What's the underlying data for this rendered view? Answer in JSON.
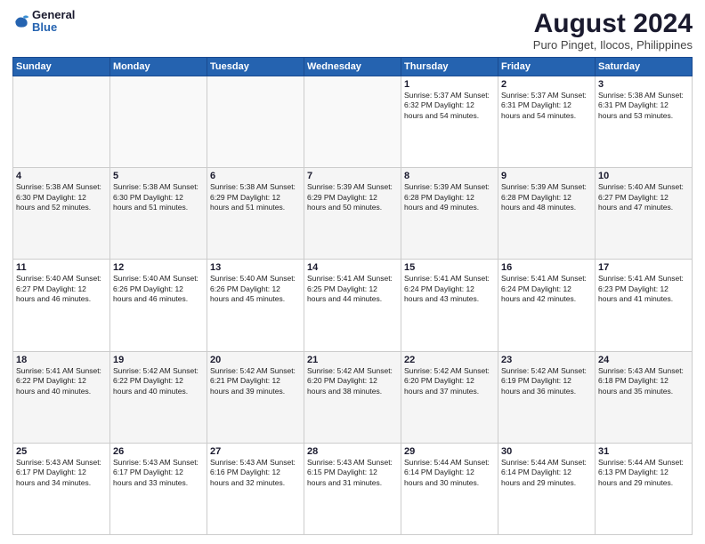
{
  "header": {
    "logo_line1": "General",
    "logo_line2": "Blue",
    "month_year": "August 2024",
    "location": "Puro Pinget, Ilocos, Philippines"
  },
  "days_of_week": [
    "Sunday",
    "Monday",
    "Tuesday",
    "Wednesday",
    "Thursday",
    "Friday",
    "Saturday"
  ],
  "weeks": [
    [
      {
        "day": "",
        "text": ""
      },
      {
        "day": "",
        "text": ""
      },
      {
        "day": "",
        "text": ""
      },
      {
        "day": "",
        "text": ""
      },
      {
        "day": "1",
        "text": "Sunrise: 5:37 AM\nSunset: 6:32 PM\nDaylight: 12 hours\nand 54 minutes."
      },
      {
        "day": "2",
        "text": "Sunrise: 5:37 AM\nSunset: 6:31 PM\nDaylight: 12 hours\nand 54 minutes."
      },
      {
        "day": "3",
        "text": "Sunrise: 5:38 AM\nSunset: 6:31 PM\nDaylight: 12 hours\nand 53 minutes."
      }
    ],
    [
      {
        "day": "4",
        "text": "Sunrise: 5:38 AM\nSunset: 6:30 PM\nDaylight: 12 hours\nand 52 minutes."
      },
      {
        "day": "5",
        "text": "Sunrise: 5:38 AM\nSunset: 6:30 PM\nDaylight: 12 hours\nand 51 minutes."
      },
      {
        "day": "6",
        "text": "Sunrise: 5:38 AM\nSunset: 6:29 PM\nDaylight: 12 hours\nand 51 minutes."
      },
      {
        "day": "7",
        "text": "Sunrise: 5:39 AM\nSunset: 6:29 PM\nDaylight: 12 hours\nand 50 minutes."
      },
      {
        "day": "8",
        "text": "Sunrise: 5:39 AM\nSunset: 6:28 PM\nDaylight: 12 hours\nand 49 minutes."
      },
      {
        "day": "9",
        "text": "Sunrise: 5:39 AM\nSunset: 6:28 PM\nDaylight: 12 hours\nand 48 minutes."
      },
      {
        "day": "10",
        "text": "Sunrise: 5:40 AM\nSunset: 6:27 PM\nDaylight: 12 hours\nand 47 minutes."
      }
    ],
    [
      {
        "day": "11",
        "text": "Sunrise: 5:40 AM\nSunset: 6:27 PM\nDaylight: 12 hours\nand 46 minutes."
      },
      {
        "day": "12",
        "text": "Sunrise: 5:40 AM\nSunset: 6:26 PM\nDaylight: 12 hours\nand 46 minutes."
      },
      {
        "day": "13",
        "text": "Sunrise: 5:40 AM\nSunset: 6:26 PM\nDaylight: 12 hours\nand 45 minutes."
      },
      {
        "day": "14",
        "text": "Sunrise: 5:41 AM\nSunset: 6:25 PM\nDaylight: 12 hours\nand 44 minutes."
      },
      {
        "day": "15",
        "text": "Sunrise: 5:41 AM\nSunset: 6:24 PM\nDaylight: 12 hours\nand 43 minutes."
      },
      {
        "day": "16",
        "text": "Sunrise: 5:41 AM\nSunset: 6:24 PM\nDaylight: 12 hours\nand 42 minutes."
      },
      {
        "day": "17",
        "text": "Sunrise: 5:41 AM\nSunset: 6:23 PM\nDaylight: 12 hours\nand 41 minutes."
      }
    ],
    [
      {
        "day": "18",
        "text": "Sunrise: 5:41 AM\nSunset: 6:22 PM\nDaylight: 12 hours\nand 40 minutes."
      },
      {
        "day": "19",
        "text": "Sunrise: 5:42 AM\nSunset: 6:22 PM\nDaylight: 12 hours\nand 40 minutes."
      },
      {
        "day": "20",
        "text": "Sunrise: 5:42 AM\nSunset: 6:21 PM\nDaylight: 12 hours\nand 39 minutes."
      },
      {
        "day": "21",
        "text": "Sunrise: 5:42 AM\nSunset: 6:20 PM\nDaylight: 12 hours\nand 38 minutes."
      },
      {
        "day": "22",
        "text": "Sunrise: 5:42 AM\nSunset: 6:20 PM\nDaylight: 12 hours\nand 37 minutes."
      },
      {
        "day": "23",
        "text": "Sunrise: 5:42 AM\nSunset: 6:19 PM\nDaylight: 12 hours\nand 36 minutes."
      },
      {
        "day": "24",
        "text": "Sunrise: 5:43 AM\nSunset: 6:18 PM\nDaylight: 12 hours\nand 35 minutes."
      }
    ],
    [
      {
        "day": "25",
        "text": "Sunrise: 5:43 AM\nSunset: 6:17 PM\nDaylight: 12 hours\nand 34 minutes."
      },
      {
        "day": "26",
        "text": "Sunrise: 5:43 AM\nSunset: 6:17 PM\nDaylight: 12 hours\nand 33 minutes."
      },
      {
        "day": "27",
        "text": "Sunrise: 5:43 AM\nSunset: 6:16 PM\nDaylight: 12 hours\nand 32 minutes."
      },
      {
        "day": "28",
        "text": "Sunrise: 5:43 AM\nSunset: 6:15 PM\nDaylight: 12 hours\nand 31 minutes."
      },
      {
        "day": "29",
        "text": "Sunrise: 5:44 AM\nSunset: 6:14 PM\nDaylight: 12 hours\nand 30 minutes."
      },
      {
        "day": "30",
        "text": "Sunrise: 5:44 AM\nSunset: 6:14 PM\nDaylight: 12 hours\nand 29 minutes."
      },
      {
        "day": "31",
        "text": "Sunrise: 5:44 AM\nSunset: 6:13 PM\nDaylight: 12 hours\nand 29 minutes."
      }
    ]
  ]
}
